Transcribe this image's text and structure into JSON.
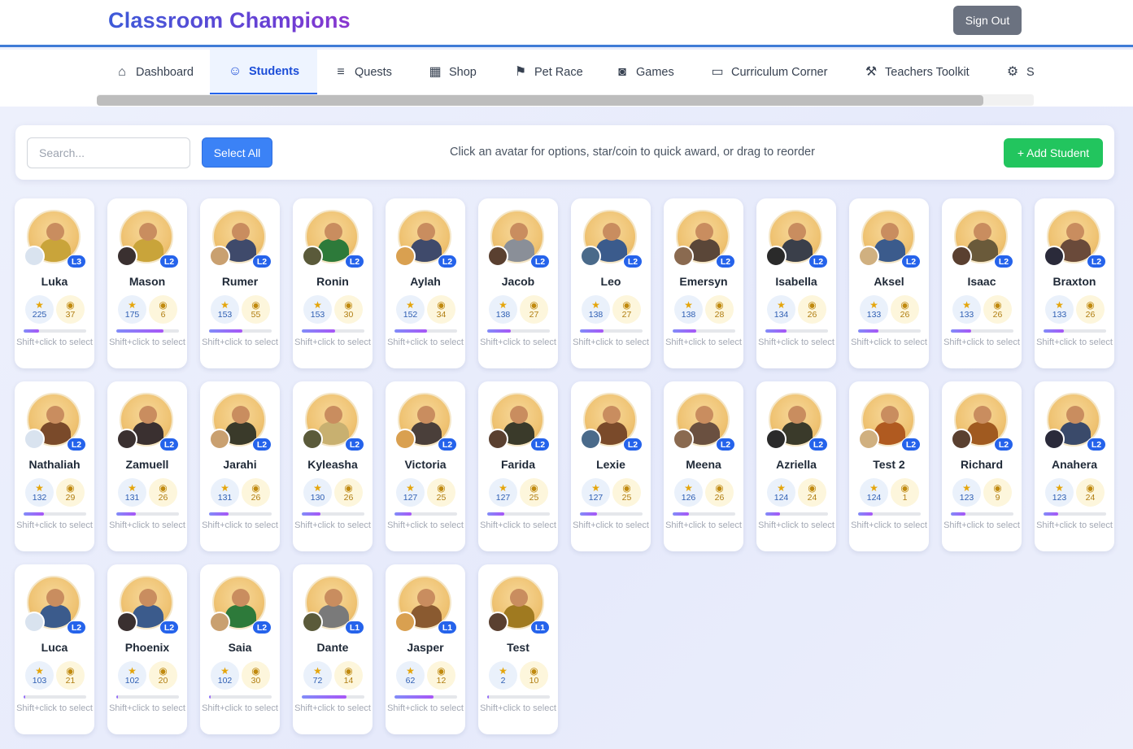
{
  "app": {
    "title": "Classroom Champions",
    "sign_out": "Sign Out"
  },
  "nav": {
    "tabs": [
      {
        "label": "Dashboard",
        "icon": "house-icon"
      },
      {
        "label": "Students",
        "icon": "users-icon",
        "active": true
      },
      {
        "label": "Quests",
        "icon": "scroll-icon"
      },
      {
        "label": "Shop",
        "icon": "shop-icon"
      },
      {
        "label": "Pet Race",
        "icon": "flag-icon"
      },
      {
        "label": "Games",
        "icon": "gamepad-icon"
      },
      {
        "label": "Curriculum Corner",
        "icon": "book-icon"
      },
      {
        "label": "Teachers Toolkit",
        "icon": "tools-icon"
      },
      {
        "label": "S",
        "icon": "gear-icon"
      }
    ]
  },
  "toolbar": {
    "search_placeholder": "Search...",
    "select_all": "Select All",
    "hint": "Click an avatar for options, star/coin to quick award, or drag to reorder",
    "add_student": "+ Add Student"
  },
  "card_hint": "Shift+click to select",
  "colors": {
    "accent_blue": "#3b82f6",
    "level_badge": "#2563eb",
    "add_green": "#22c55e",
    "sign_out_gray": "#6b7280"
  },
  "students": [
    {
      "name": "Luka",
      "level": "L3",
      "stars": "225",
      "coins": "37",
      "xp": 0.25
    },
    {
      "name": "Mason",
      "level": "L2",
      "stars": "175",
      "coins": "6",
      "xp": 0.75
    },
    {
      "name": "Rumer",
      "level": "L2",
      "stars": "153",
      "coins": "55",
      "xp": 0.53
    },
    {
      "name": "Ronin",
      "level": "L2",
      "stars": "153",
      "coins": "30",
      "xp": 0.53
    },
    {
      "name": "Aylah",
      "level": "L2",
      "stars": "152",
      "coins": "34",
      "xp": 0.52
    },
    {
      "name": "Jacob",
      "level": "L2",
      "stars": "138",
      "coins": "27",
      "xp": 0.38
    },
    {
      "name": "Leo",
      "level": "L2",
      "stars": "138",
      "coins": "27",
      "xp": 0.38
    },
    {
      "name": "Emersyn",
      "level": "L2",
      "stars": "138",
      "coins": "28",
      "xp": 0.38
    },
    {
      "name": "Isabella",
      "level": "L2",
      "stars": "134",
      "coins": "26",
      "xp": 0.34
    },
    {
      "name": "Aksel",
      "level": "L2",
      "stars": "133",
      "coins": "26",
      "xp": 0.33
    },
    {
      "name": "Isaac",
      "level": "L2",
      "stars": "133",
      "coins": "26",
      "xp": 0.33
    },
    {
      "name": "Braxton",
      "level": "L2",
      "stars": "133",
      "coins": "26",
      "xp": 0.33
    },
    {
      "name": "Nathaliah",
      "level": "L2",
      "stars": "132",
      "coins": "29",
      "xp": 0.32
    },
    {
      "name": "Zamuell",
      "level": "L2",
      "stars": "131",
      "coins": "26",
      "xp": 0.31
    },
    {
      "name": "Jarahi",
      "level": "L2",
      "stars": "131",
      "coins": "26",
      "xp": 0.31
    },
    {
      "name": "Kyleasha",
      "level": "L2",
      "stars": "130",
      "coins": "26",
      "xp": 0.3
    },
    {
      "name": "Victoria",
      "level": "L2",
      "stars": "127",
      "coins": "25",
      "xp": 0.27
    },
    {
      "name": "Farida",
      "level": "L2",
      "stars": "127",
      "coins": "25",
      "xp": 0.27
    },
    {
      "name": "Lexie",
      "level": "L2",
      "stars": "127",
      "coins": "25",
      "xp": 0.27
    },
    {
      "name": "Meena",
      "level": "L2",
      "stars": "126",
      "coins": "26",
      "xp": 0.26
    },
    {
      "name": "Azriella",
      "level": "L2",
      "stars": "124",
      "coins": "24",
      "xp": 0.24
    },
    {
      "name": "Test 2",
      "level": "L2",
      "stars": "124",
      "coins": "1",
      "xp": 0.24
    },
    {
      "name": "Richard",
      "level": "L2",
      "stars": "123",
      "coins": "9",
      "xp": 0.23
    },
    {
      "name": "Anahera",
      "level": "L2",
      "stars": "123",
      "coins": "24",
      "xp": 0.23
    },
    {
      "name": "Luca",
      "level": "L2",
      "stars": "103",
      "coins": "21",
      "xp": 0.03
    },
    {
      "name": "Phoenix",
      "level": "L2",
      "stars": "102",
      "coins": "20",
      "xp": 0.02
    },
    {
      "name": "Saia",
      "level": "L2",
      "stars": "102",
      "coins": "30",
      "xp": 0.02
    },
    {
      "name": "Dante",
      "level": "L1",
      "stars": "72",
      "coins": "14",
      "xp": 0.72
    },
    {
      "name": "Jasper",
      "level": "L1",
      "stars": "62",
      "coins": "12",
      "xp": 0.62
    },
    {
      "name": "Test",
      "level": "L1",
      "stars": "2",
      "coins": "10",
      "xp": 0.02
    }
  ]
}
